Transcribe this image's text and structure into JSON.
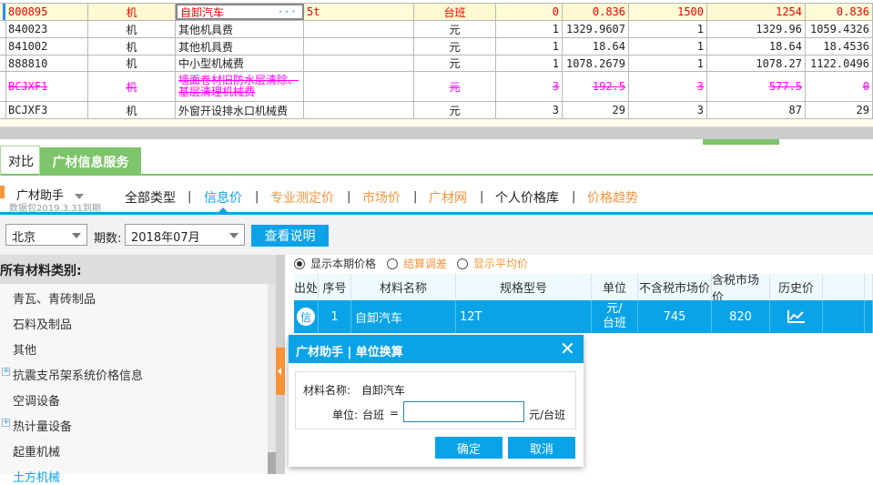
{
  "grid": {
    "rows": [
      {
        "code": "800895",
        "type": "机",
        "name": "自卸汽车",
        "spec": "5t",
        "unit": "台班",
        "c1": "0",
        "c2": "0.836",
        "c3": "1500",
        "c4": "1254",
        "c5": "0.836",
        "style": "selected"
      },
      {
        "code": "840023",
        "type": "机",
        "name": "其他机具费",
        "spec": "",
        "unit": "元",
        "c1": "1",
        "c2": "1329.9607",
        "c3": "1",
        "c4": "1329.96",
        "c5": "1059.4326",
        "style": "normal"
      },
      {
        "code": "841002",
        "type": "机",
        "name": "其他机具费",
        "spec": "",
        "unit": "元",
        "c1": "1",
        "c2": "18.64",
        "c3": "1",
        "c4": "18.64",
        "c5": "18.4536",
        "style": "normal"
      },
      {
        "code": "888810",
        "type": "机",
        "name": "中小型机械费",
        "spec": "",
        "unit": "元",
        "c1": "1",
        "c2": "1078.2679",
        "c3": "1",
        "c4": "1078.27",
        "c5": "1122.0496",
        "style": "normal"
      },
      {
        "code": "BCJXF1",
        "type": "机",
        "name": "墙面卷材旧防水层清除、基层清理机械费",
        "spec": "",
        "unit": "元",
        "c1": "3",
        "c2": "192.5",
        "c3": "3",
        "c4": "577.5",
        "c5": "0",
        "style": "deleted"
      },
      {
        "code": "BCJXF3",
        "type": "机",
        "name": "外窗开设排水口机械费",
        "spec": "",
        "unit": "元",
        "c1": "3",
        "c2": "29",
        "c3": "3",
        "c4": "87",
        "c5": "29",
        "style": "normal"
      }
    ],
    "ellipsis": "···"
  },
  "tabs": {
    "compare": "对比",
    "info_service": "广材信息服务"
  },
  "assistant": {
    "name": "广材助手",
    "expiry": "数据包2019.3.31到期"
  },
  "nav": [
    "全部类型",
    "信息价",
    "专业测定价",
    "市场价",
    "广材网",
    "个人价格库",
    "价格趋势"
  ],
  "filter": {
    "region": "北京",
    "period_label": "期数:",
    "period": "2018年07月",
    "explain": "查看说明"
  },
  "categories": {
    "title": "所有材料类别:",
    "items": [
      "青瓦、青砖制品",
      "石料及制品",
      "其他",
      "抗震支吊架系统价格信息",
      "空调设备",
      "热计量设备",
      "起重机械",
      "土方机械"
    ]
  },
  "radios": [
    {
      "label": "显示本期价格",
      "checked": true
    },
    {
      "label": "结算调差",
      "checked": false
    },
    {
      "label": "显示平均价",
      "checked": false
    }
  ],
  "table": {
    "headers": [
      "出处",
      "序号",
      "材料名称",
      "规格型号",
      "单位",
      "不含税市场价",
      "含税市场价",
      "历史价"
    ],
    "row": {
      "source": "信",
      "seq": "1",
      "name": "自卸汽车",
      "spec": "12T",
      "unit": "元/台班",
      "price_ex": "745",
      "price_inc": "820"
    }
  },
  "dialog": {
    "title": "广材助手 | 单位换算",
    "name_label": "材料名称:",
    "name_value": "自卸汽车",
    "unit_label": "单位:",
    "unit_from": "台班",
    "equals": "=",
    "input_value": "",
    "unit_to": "元/台班",
    "ok": "确定",
    "cancel": "取消"
  },
  "colors": {
    "accent": "#0aa3e8",
    "green": "#7dc46a",
    "orange": "#f7943a",
    "deleted": "#ff00ff",
    "selected": "#ee0000"
  }
}
